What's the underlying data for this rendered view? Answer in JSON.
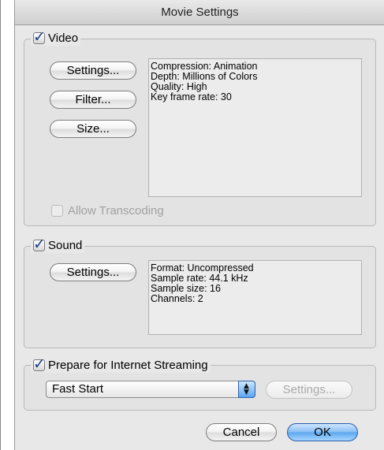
{
  "window": {
    "title": "Movie Settings"
  },
  "video": {
    "label": "Video",
    "checked": true,
    "buttons": {
      "settings": "Settings...",
      "filter": "Filter...",
      "size": "Size..."
    },
    "info": [
      "Compression: Animation",
      "Depth: Millions of Colors",
      "Quality: High",
      "Key frame rate: 30"
    ],
    "allow_transcoding": "Allow Transcoding"
  },
  "sound": {
    "label": "Sound",
    "checked": true,
    "buttons": {
      "settings": "Settings..."
    },
    "info": [
      "Format: Uncompressed",
      "Sample rate: 44.1 kHz",
      "Sample size: 16",
      "Channels: 2"
    ]
  },
  "streaming": {
    "label": "Prepare for Internet Streaming",
    "checked": true,
    "selected": "Fast Start",
    "settings_label": "Settings..."
  },
  "footer": {
    "cancel": "Cancel",
    "ok": "OK"
  },
  "icons": {
    "checkbox": "checkmark-icon",
    "stepper": "up-down-arrows-icon"
  },
  "colors": {
    "default_button": "#5ca6ef",
    "checkmark": "#1b3f85"
  }
}
